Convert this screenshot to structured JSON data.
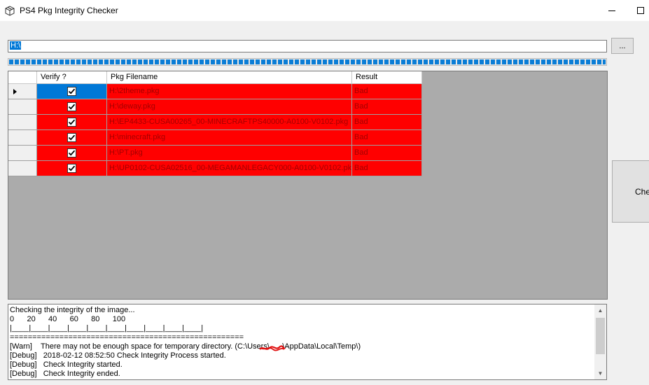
{
  "window": {
    "title": "PS4 Pkg Integrity Checker"
  },
  "path": {
    "value": "H:\\",
    "browse_label": "..."
  },
  "progress": {
    "fraction": 1.0,
    "color": "#0a7dd6"
  },
  "grid": {
    "columns": [
      "Verify ?",
      "Pkg Filename",
      "Result"
    ],
    "row_color": "#ff0000",
    "rows": [
      {
        "verify": true,
        "filename": "H:\\2theme.pkg",
        "result": "Bad"
      },
      {
        "verify": true,
        "filename": "H:\\deway.pkg",
        "result": "Bad"
      },
      {
        "verify": true,
        "filename": "H:\\EP4433-CUSA00265_00-MINECRAFTPS40000-A0100-V0102.pkg",
        "result": "Bad"
      },
      {
        "verify": true,
        "filename": "H:\\minecraft.pkg",
        "result": "Bad"
      },
      {
        "verify": true,
        "filename": "H:\\PT.pkg",
        "result": "Bad"
      },
      {
        "verify": true,
        "filename": "H:\\UP0102-CUSA02516_00-MEGAMANLEGACY000-A0100-V0102.pkg",
        "result": "Bad"
      }
    ]
  },
  "side_button": {
    "label": "Che"
  },
  "log": {
    "lines": [
      "Checking the integrity of the image...",
      "0      20      40      60      80      100",
      "|____|____|____|____|____|____|____|____|____|____|",
      "====================================================",
      "[Warn]    There may not be enough space for temporary directory. (C:\\Users\\      \\AppData\\Local\\Temp\\)",
      "[Debug]   2018-02-12 08:52:50 Check Integrity Process started.",
      "[Debug]   Check Integrity started.",
      "[Debug]   Check Integrity ended."
    ]
  }
}
